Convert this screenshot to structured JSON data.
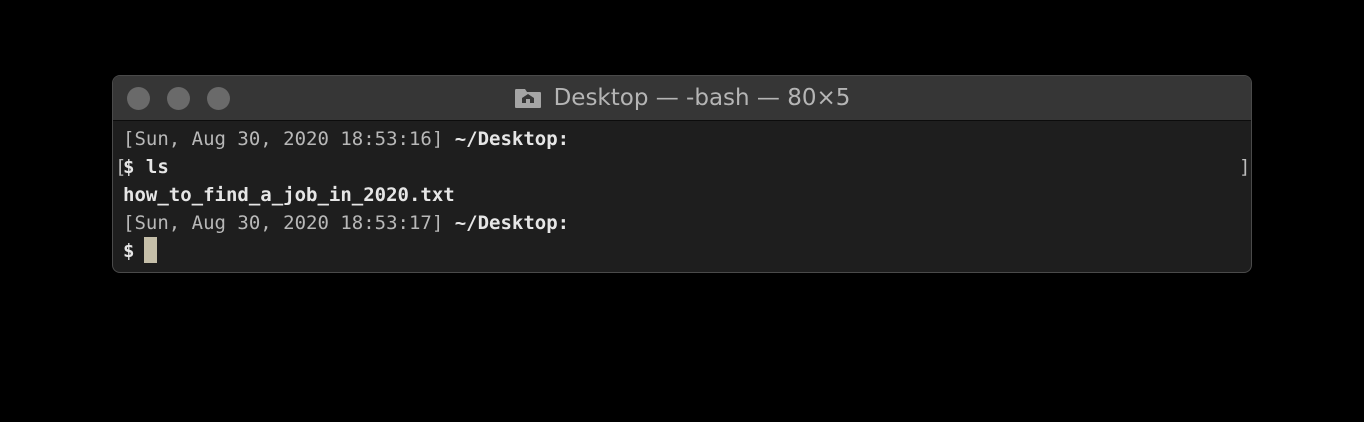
{
  "window": {
    "title": "Desktop — -bash — 80×5",
    "icon": "folder-home-icon"
  },
  "terminal": {
    "lines": [
      {
        "prefix": "[Sun, Aug 30, 2020 18:53:16]",
        "path": " ~/Desktop:"
      },
      {
        "prompt": "$ ls"
      },
      {
        "output": "how_to_find_a_job_in_2020.txt"
      },
      {
        "prefix": "[Sun, Aug 30, 2020 18:53:17]",
        "path": " ~/Desktop:"
      },
      {
        "prompt": "$"
      }
    ],
    "mark_left": "[",
    "mark_right": "]"
  },
  "colors": {
    "background": "#000000",
    "terminal_bg": "#1e1e1e",
    "titlebar_bg": "#363636",
    "cursor": "#c5bfa9"
  }
}
